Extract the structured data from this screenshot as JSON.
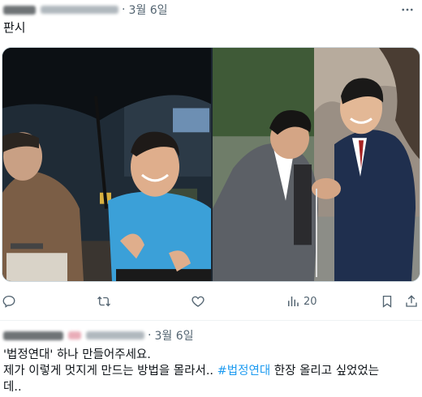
{
  "post1": {
    "date": "3월 6일",
    "text": "판시",
    "media": [
      {
        "description": "two men seated under a black umbrella at an outdoor night event"
      },
      {
        "description": "two men in suits shaking hands and laughing outdoors"
      }
    ],
    "actions": {
      "reply_icon": "reply-icon",
      "retweet_icon": "retweet-icon",
      "like_icon": "heart-icon",
      "views_icon": "views-icon",
      "views_count": "20",
      "bookmark_icon": "bookmark-icon",
      "share_icon": "share-icon"
    }
  },
  "post2": {
    "date": "3월 6일",
    "line1": "'법정연대' 하나 만들어주세요.",
    "line2_before": "제가 이렇게 멋지게 만드는 방법을 몰라서.. ",
    "hashtag": "#법정연대",
    "line2_after": " 한장 올리고 싶었었는",
    "line3": "데.."
  },
  "colors": {
    "text": "#0f1419",
    "muted": "#536471",
    "link": "#1d9bf0",
    "border": "#cfd9de"
  }
}
